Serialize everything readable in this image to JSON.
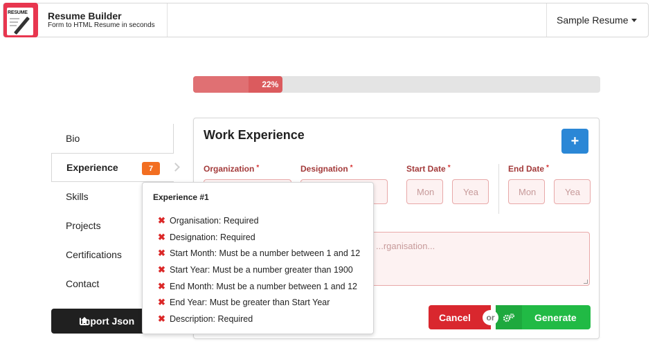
{
  "header": {
    "logo_text": "RESUME",
    "title": "Resume Builder",
    "subtitle": "Form to HTML Resume in seconds",
    "resume_select": "Sample Resume"
  },
  "progress": {
    "value_percent": 22,
    "label": "22%"
  },
  "sidebar": {
    "items": [
      {
        "label": "Bio",
        "active": false
      },
      {
        "label": "Experience",
        "active": true,
        "badge": "7"
      },
      {
        "label": "Skills",
        "active": false
      },
      {
        "label": "Projects",
        "active": false
      },
      {
        "label": "Certifications",
        "active": false
      },
      {
        "label": "Contact",
        "active": false
      }
    ],
    "import_label": "Import Json"
  },
  "panel": {
    "title": "Work Experience",
    "add_label": "+",
    "fields": {
      "organization": "Organization",
      "designation": "Designation",
      "start_date": "Start Date",
      "end_date": "End Date",
      "required_mark": "*"
    },
    "placeholders": {
      "start_month": "Mon",
      "start_year": "Yea",
      "end_month": "Mon",
      "end_year": "Yea",
      "description": "...rganisation..."
    },
    "cancel_label": "Cancel",
    "or_label": "or",
    "generate_label": "Generate"
  },
  "tooltip": {
    "title": "Experience #1",
    "errors": [
      "Organisation: Required",
      "Designation: Required",
      "Start Month: Must be a number between 1 and 12",
      "Start Year: Must be a number greater than 1900",
      "End Month: Must be a number between 1 and 12",
      "End Year: Must be greater than Start Year",
      "Description: Required"
    ]
  },
  "colors": {
    "progress": "#db5b5e",
    "badge": "#f26e21",
    "add_button": "#2b87d6",
    "cancel": "#d9272e",
    "generate": "#21ba45",
    "error": "#db2828"
  },
  "icons": {
    "logo": "resume-pen-icon",
    "caret": "caret-down-icon",
    "add": "plus-icon",
    "import": "upload-icon",
    "generate": "cogs-icon",
    "error": "x-icon",
    "arrow": "chevron-right-icon"
  }
}
